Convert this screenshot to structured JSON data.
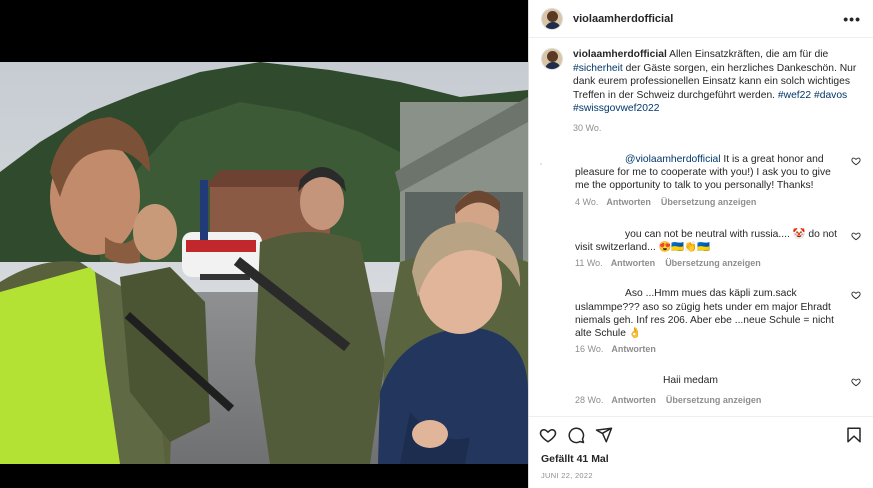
{
  "post": {
    "username": "violaamherdofficial",
    "more_label": "•••"
  },
  "caption": {
    "username": "violaamherdofficial",
    "text_1": " Allen Einsatzkräften, die am für die ",
    "tag_sicherheit": "#sicherheit",
    "text_2": " der Gäste sorgen, ein herzliches Dankeschön. Nur dank eurem professionellen Einsatz kann ein solch wichtiges Treffen in der Schweiz durchgeführt werden. ",
    "tag_wef22": "#wef22",
    "tag_davos": "#davos",
    "tag_swissgovwef2022": "#swissgovwef2022",
    "time": "30 Wo."
  },
  "comments": [
    {
      "mention": "@violaamherdofficial",
      "text": " It is a great honor and pleasure for me to cooperate with you!) I ask you to give me the opportunity to talk to you personally! Thanks!",
      "time": "4 Wo.",
      "reply_label": "Antworten",
      "translate_label": "Übersetzung anzeigen"
    },
    {
      "text": "you can not be neutral with russia.... 🤡 do not visit switzerland... 😍🇺🇦👏🇺🇦",
      "time": "11 Wo.",
      "reply_label": "Antworten",
      "translate_label": "Übersetzung anzeigen"
    },
    {
      "text": "Aso ...Hmm mues das käpli zum.sack uslammpe??? aso so zügig hets under em major Ehradt niemals geh. Inf res 206. Aber ebe ...neue Schule = nicht alte Schule 👌",
      "time": "16 Wo.",
      "reply_label": "Antworten"
    },
    {
      "text": "Haii medam",
      "time": "28 Wo.",
      "reply_label": "Antworten",
      "translate_label": "Übersetzung anzeigen"
    }
  ],
  "footer": {
    "likes": "Gefällt 41 Mal",
    "date": "JUNI 22, 2022"
  },
  "icons": {
    "like": "heart-icon",
    "comment": "comment-icon",
    "share": "share-icon",
    "save": "bookmark-icon",
    "more": "more-icon"
  },
  "colors": {
    "hashtag": "#00376b",
    "muted": "#8e8e8e",
    "text": "#262626"
  }
}
